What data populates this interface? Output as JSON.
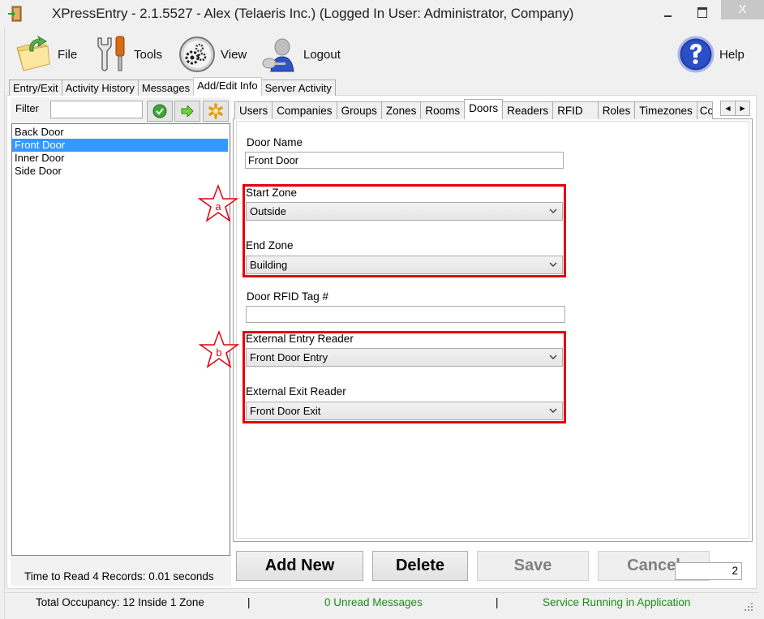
{
  "window": {
    "title": "XPressEntry - 2.1.5527 - Alex (Telaeris Inc.) (Logged In User: Administrator, Company)",
    "close_label": "X"
  },
  "toolbar": {
    "file_label": "File",
    "tools_label": "Tools",
    "view_label": "View",
    "logout_label": "Logout",
    "help_label": "Help"
  },
  "main_tabs": [
    {
      "label": "Entry/Exit",
      "active": false
    },
    {
      "label": "Activity History",
      "active": false
    },
    {
      "label": "Messages",
      "active": false
    },
    {
      "label": "Add/Edit Info",
      "active": true
    },
    {
      "label": "Server Activity",
      "active": false
    }
  ],
  "left_panel": {
    "filter_label": "Filter",
    "filter_value": "",
    "doors": [
      {
        "name": "Back Door",
        "selected": false
      },
      {
        "name": "Front Door",
        "selected": true
      },
      {
        "name": "Inner Door",
        "selected": false
      },
      {
        "name": "Side Door",
        "selected": false
      }
    ],
    "read_time": "Time to Read 4 Records: 0.01 seconds"
  },
  "sub_tabs": [
    {
      "label": "Users",
      "active": false
    },
    {
      "label": "Companies",
      "active": false
    },
    {
      "label": "Groups",
      "active": false
    },
    {
      "label": "Zones",
      "active": false
    },
    {
      "label": "Rooms",
      "active": false
    },
    {
      "label": "Doors",
      "active": true
    },
    {
      "label": "Readers",
      "active": false
    },
    {
      "label": "RFID",
      "active": false
    },
    {
      "label": "Roles",
      "active": false
    },
    {
      "label": "Timezones",
      "active": false
    },
    {
      "label": "Co",
      "active": false
    }
  ],
  "form": {
    "door_name_label": "Door Name",
    "door_name_value": "Front Door",
    "start_zone_label": "Start Zone",
    "start_zone_value": "Outside",
    "end_zone_label": "End Zone",
    "end_zone_value": "Building",
    "rfid_label": "Door RFID Tag #",
    "rfid_value": "",
    "entry_reader_label": "External Entry Reader",
    "entry_reader_value": "Front Door Entry",
    "exit_reader_label": "External Exit Reader",
    "exit_reader_value": "Front Door Exit"
  },
  "annotations": {
    "a": "a",
    "b": "b",
    "highlight_color": "#e3000f"
  },
  "buttons": {
    "add_new": "Add New",
    "delete": "Delete",
    "save": "Save",
    "cancel": "Cancel",
    "count_value": "2"
  },
  "status": {
    "occupancy": "Total Occupancy: 12 Inside 1 Zone",
    "separator": "|",
    "messages": "0 Unread Messages",
    "service": "Service Running in Application",
    "ok_color": "#1e8a1e"
  }
}
